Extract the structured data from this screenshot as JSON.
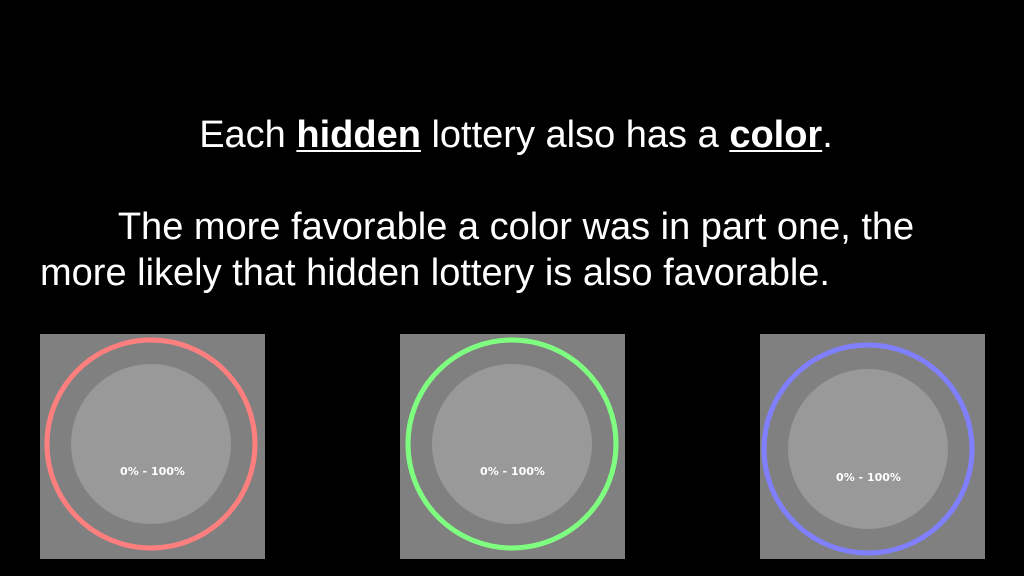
{
  "heading": {
    "pre": "Each ",
    "word1": "hidden",
    "mid": " lottery also has a ",
    "word2": "color",
    "post": "."
  },
  "explanation": {
    "line1": "The more favorable a color was in part one, the",
    "line2": "more likely that hidden lottery is also favorable."
  },
  "lotteries": [
    {
      "color": "#ff7f7f",
      "range_label": "0% - 100%"
    },
    {
      "color": "#7fff7f",
      "range_label": "0% - 100%"
    },
    {
      "color": "#7f7fff",
      "range_label": "0% - 100%"
    }
  ]
}
